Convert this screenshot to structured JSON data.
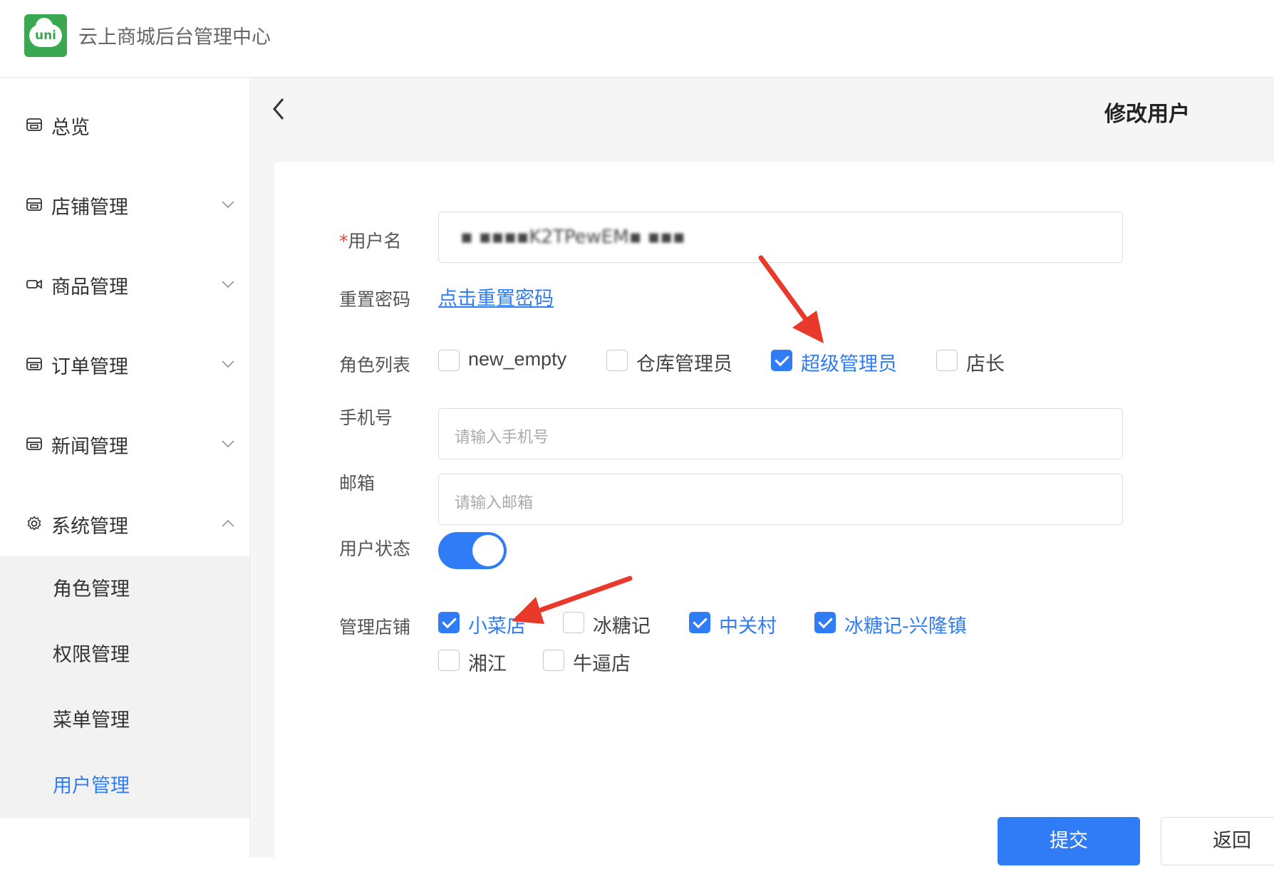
{
  "app": {
    "logo_text": "uni",
    "title": "云上商城后台管理中心"
  },
  "sidebar": {
    "items": [
      {
        "label": "总览",
        "icon": "store-icon",
        "expandable": false
      },
      {
        "label": "店铺管理",
        "icon": "store-icon",
        "expandable": true
      },
      {
        "label": "商品管理",
        "icon": "video-icon",
        "expandable": true
      },
      {
        "label": "订单管理",
        "icon": "store-icon",
        "expandable": true
      },
      {
        "label": "新闻管理",
        "icon": "store-icon",
        "expandable": true
      },
      {
        "label": "系统管理",
        "icon": "gear-icon",
        "expandable": true,
        "expanded": true
      }
    ],
    "submenu": [
      {
        "label": "角色管理",
        "active": false
      },
      {
        "label": "权限管理",
        "active": false
      },
      {
        "label": "菜单管理",
        "active": false
      },
      {
        "label": "用户管理",
        "active": true
      }
    ]
  },
  "page": {
    "title": "修改用户"
  },
  "form": {
    "username": {
      "label": "用户名",
      "required_mark": "*",
      "value": "▪ ▪▪▪▪K2TPewEM▪ ▪▪▪"
    },
    "reset_password": {
      "label": "重置密码",
      "link": "点击重置密码"
    },
    "roles": {
      "label": "角色列表",
      "options": [
        {
          "label": "new_empty",
          "checked": false
        },
        {
          "label": "仓库管理员",
          "checked": false
        },
        {
          "label": "超级管理员",
          "checked": true
        },
        {
          "label": "店长",
          "checked": false
        }
      ]
    },
    "phone": {
      "label": "手机号",
      "placeholder": "请输入手机号"
    },
    "email": {
      "label": "邮箱",
      "placeholder": "请输入邮箱"
    },
    "status": {
      "label": "用户状态",
      "enabled": true
    },
    "stores": {
      "label": "管理店铺",
      "options": [
        {
          "label": "小菜店",
          "checked": true
        },
        {
          "label": "冰糖记",
          "checked": false
        },
        {
          "label": "中关村",
          "checked": true
        },
        {
          "label": "冰糖记-兴隆镇",
          "checked": true
        },
        {
          "label": "湘江",
          "checked": false
        },
        {
          "label": "牛逼店",
          "checked": false
        }
      ]
    }
  },
  "actions": {
    "submit_label": "提交",
    "back_label": "返回"
  },
  "colors": {
    "primary": "#2f7cf6",
    "brand_green": "#3aa851",
    "annotation_arrow": "#e8392b"
  }
}
